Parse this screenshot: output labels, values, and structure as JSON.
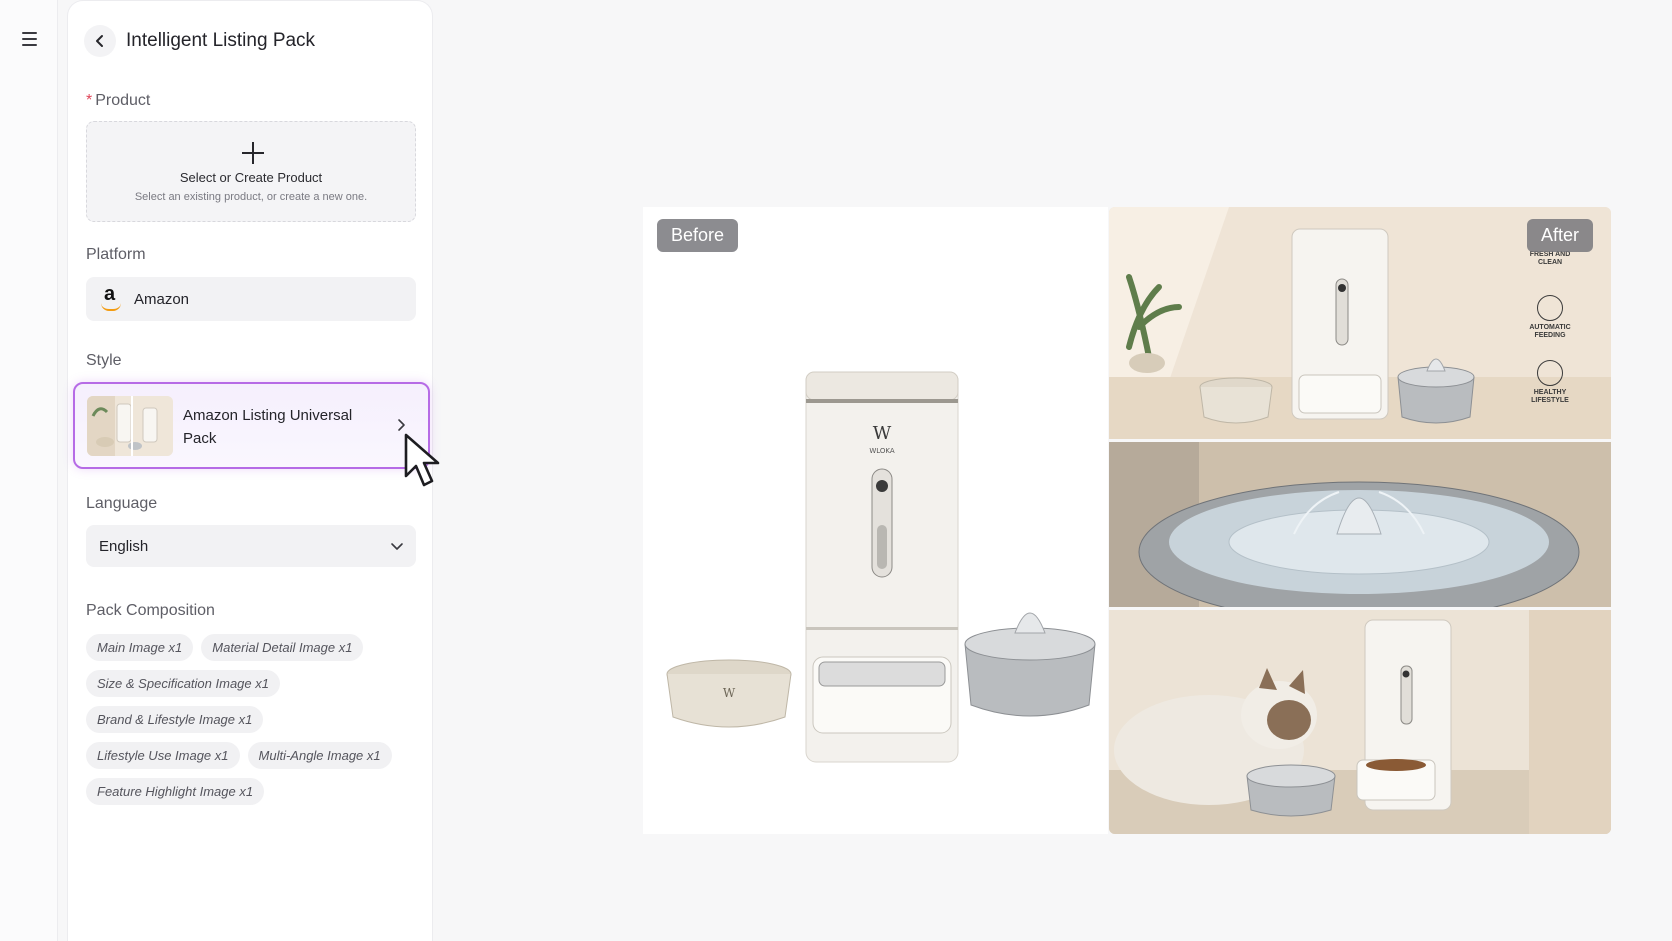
{
  "sidebar": {
    "menu_icon": "hamburger-menu-icon"
  },
  "panel": {
    "title": "Intelligent Listing Pack",
    "product": {
      "required_mark": "*",
      "label": "Product",
      "add_title": "Select or Create Product",
      "add_subtitle": "Select an existing product, or create a new one."
    },
    "platform": {
      "label": "Platform",
      "value": "Amazon"
    },
    "style": {
      "label": "Style",
      "value": "Amazon Listing Universal Pack"
    },
    "language": {
      "label": "Language",
      "value": "English"
    },
    "pack": {
      "label": "Pack Composition",
      "tags": [
        "Main Image x1",
        "Material Detail Image x1",
        "Size & Specification Image x1",
        "Brand & Lifestyle Image x1",
        "Lifestyle Use Image x1",
        "Multi-Angle Image x1",
        "Feature Highlight Image x1"
      ]
    }
  },
  "preview": {
    "before_label": "Before",
    "after_label": "After",
    "brand": "WLOKA",
    "brand_mark": "W",
    "features": [
      "FRESH AND CLEAN",
      "AUTOMATIC FEEDING",
      "HEALTHY LIFESTYLE"
    ]
  },
  "colors": {
    "accent": "#b66be6",
    "required": "#e0465a",
    "amazon_smile": "#f39c12"
  }
}
